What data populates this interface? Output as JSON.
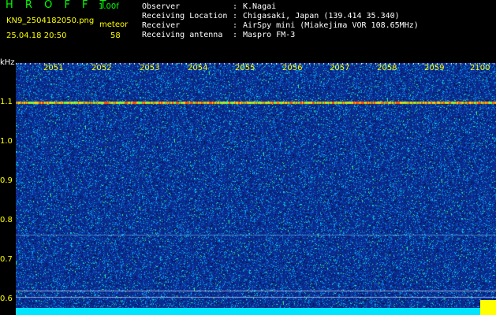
{
  "header": {
    "title": "H R O F F T",
    "version": "1.00f",
    "filename": "KN9_2504182050.png",
    "datetime": "25.04.18 20:50",
    "meteor_label": "meteor",
    "meteor_count": "58"
  },
  "info": [
    {
      "label": "Observer",
      "value": "K.Nagai"
    },
    {
      "label": "Receiving Location",
      "value": "Chigasaki, Japan (139.414 35.340)"
    },
    {
      "label": "Receiver",
      "value": "AirSpy mini (Miakejima VOR 108.65MHz)"
    },
    {
      "label": "Receiving antenna",
      "value": "Maspro FM-3"
    }
  ],
  "spectrogram": {
    "y_unit": "kHz",
    "y_labels": [
      "1.1",
      "1.0",
      "0.9",
      "0.8",
      "0.7",
      "0.6"
    ],
    "x_labels": [
      "2051",
      "2052",
      "2053",
      "2054",
      "2055",
      "2056",
      "2057",
      "2058",
      "2059",
      "2100"
    ],
    "colors": {
      "background": "#0a2a8c",
      "noise_a": "#00c8ff",
      "noise_b": "#00ff80",
      "carrier": "#ff3000",
      "axis_text": "#ffff00"
    }
  }
}
